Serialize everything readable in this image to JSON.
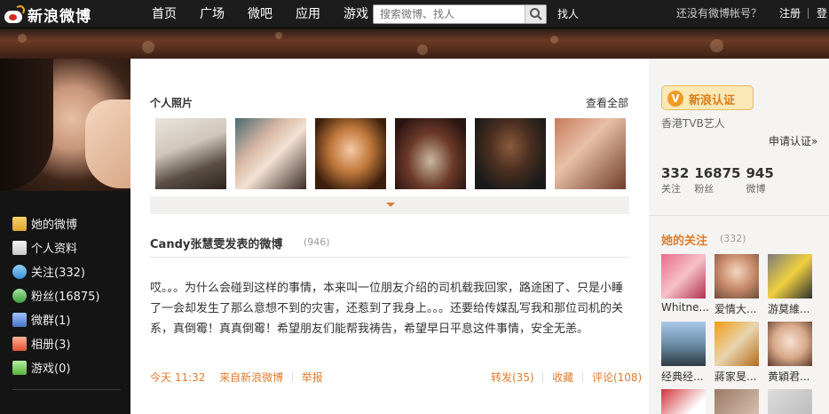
{
  "header": {
    "logo_text": "新浪微博",
    "nav": [
      "首页",
      "广场",
      "微吧",
      "应用",
      "游戏"
    ],
    "search_placeholder": "搜索微博、找人",
    "find_people": "找人",
    "no_account": "还没有微博帐号？",
    "register": "注册",
    "login": "登"
  },
  "sidebar": {
    "items": [
      {
        "label": "她的微博",
        "icon": "home-icon"
      },
      {
        "label": "个人资料",
        "icon": "profile-icon"
      },
      {
        "label": "关注(332)",
        "icon": "follow-icon"
      },
      {
        "label": "粉丝(16875)",
        "icon": "fans-icon"
      },
      {
        "label": "微群(1)",
        "icon": "group-icon"
      },
      {
        "label": "相册(3)",
        "icon": "album-icon"
      },
      {
        "label": "游戏(0)",
        "icon": "game-icon"
      }
    ]
  },
  "photos": {
    "title": "个人照片",
    "see_all": "查看全部"
  },
  "feed": {
    "title": "Candy张慧雯发表的微博",
    "count": "(946)",
    "post_text": "哎。。。为什么会碰到这样的事情，本来叫一位朋友介绍的司机载我回家，路途困了、只是小睡了一会却发生了那么意想不到的灾害，还惹到了我身上。。。还要给传媒乱写我和那位司机的关系，真倒霉！真真倒霉！希望朋友们能帮我祷告，希望早日平息这件事情，安全无恙。",
    "time": "今天 11:32",
    "source": "来自新浪微博",
    "report": "举报",
    "repost": "转发(35)",
    "favorite": "收藏",
    "comment": "评论(108)"
  },
  "profile": {
    "verify_label": "新浪认证",
    "verify_desc": "香港TVB艺人",
    "apply": "申请认证»",
    "stats": [
      {
        "num": "332",
        "label": "关注"
      },
      {
        "num": "16875",
        "label": "粉丝"
      },
      {
        "num": "945",
        "label": "微博"
      }
    ],
    "following_title": "她的关注",
    "following_count": "(332)",
    "following": [
      "Whitne...",
      "爱情大...",
      "游莫維...",
      "经典经...",
      "蔣家旻...",
      "黄穎君..."
    ]
  },
  "colors": {
    "accent": "#e07b2b",
    "topbar": "#1c1c1c",
    "sidebar_bg": "#141414"
  }
}
